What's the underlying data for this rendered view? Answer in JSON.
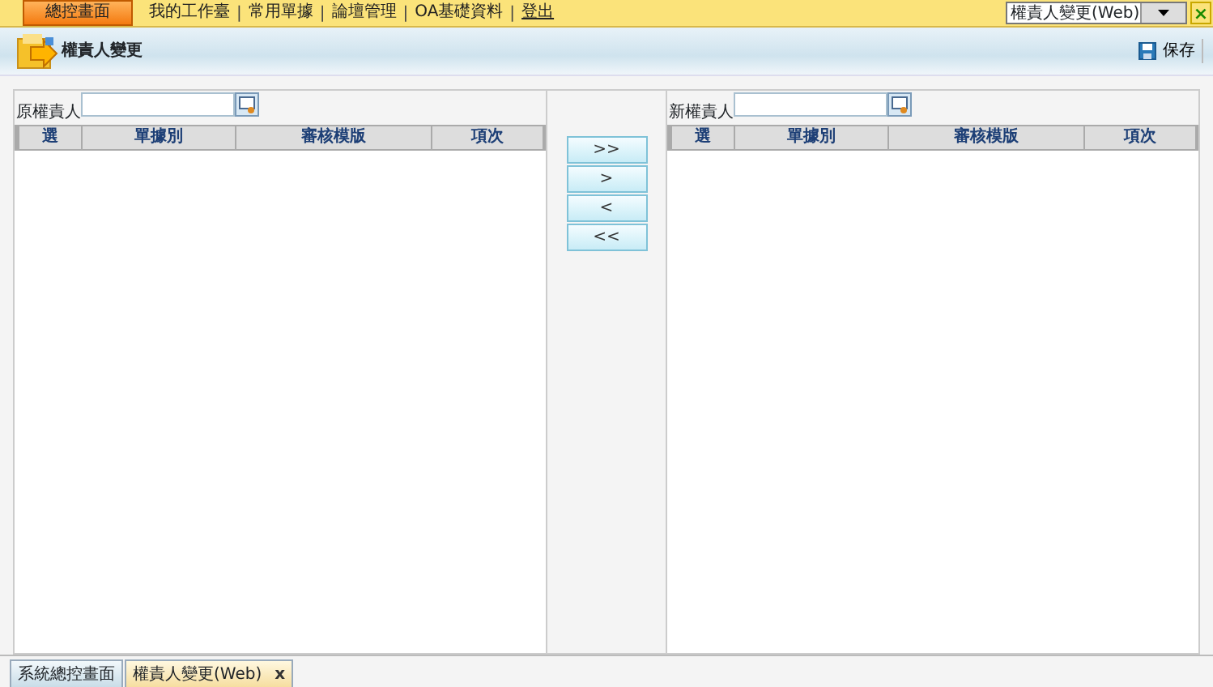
{
  "top_nav": {
    "items": [
      {
        "label": "總控畫面",
        "selected": true
      },
      {
        "label": "我的工作臺",
        "selected": false
      },
      {
        "label": "常用單據",
        "selected": false
      },
      {
        "label": "論壇管理",
        "selected": false
      },
      {
        "label": "OA基礎資料",
        "selected": false
      },
      {
        "label": "登出",
        "selected": false,
        "underlined": true
      }
    ],
    "separator": "|",
    "window_select": "權責人變更(Web)",
    "close": "×"
  },
  "header": {
    "title": "權責人變更",
    "save": "保存"
  },
  "panels": [
    {
      "label": "原權責人",
      "columns": [
        "選",
        "單據別",
        "審核模版",
        "項次"
      ]
    },
    {
      "label": "新權責人",
      "columns": [
        "選",
        "單據別",
        "審核模版",
        "項次"
      ]
    }
  ],
  "transfer_buttons": [
    ">>",
    ">",
    "<",
    "<<"
  ],
  "bottom_tabs": [
    {
      "label": "系統總控畫面",
      "selected": false
    },
    {
      "label": "權責人變更(Web)",
      "selected": true,
      "close": "x"
    }
  ]
}
